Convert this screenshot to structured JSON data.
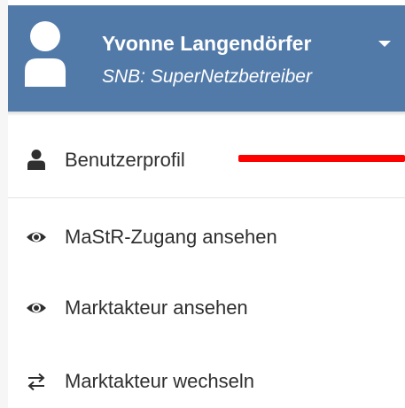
{
  "user": {
    "name": "Yvonne Langendörfer",
    "role": "SNB: SuperNetzbetreiber",
    "avatar_icon": "user-silhouette-icon",
    "menu_toggle_icon": "caret-down-icon"
  },
  "menu": {
    "items": [
      {
        "label": "Benutzerprofil",
        "icon": "user-icon"
      },
      {
        "label": "MaStR-Zugang ansehen",
        "icon": "eye-icon"
      },
      {
        "label": "Marktakteur ansehen",
        "icon": "eye-icon"
      },
      {
        "label": "Marktakteur wechseln",
        "icon": "arrows-exchange-icon"
      }
    ]
  },
  "colors": {
    "header_background": "#527aa9",
    "header_text": "#ffffff",
    "menu_text": "#2f2f2f",
    "annotation": "#ff0000"
  }
}
